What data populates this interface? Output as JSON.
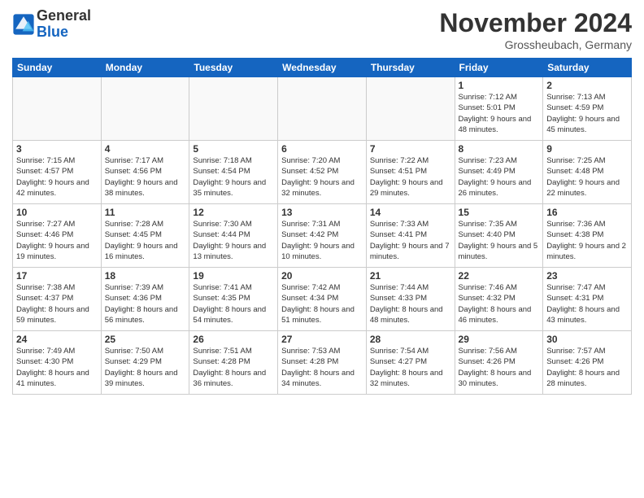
{
  "header": {
    "logo_general": "General",
    "logo_blue": "Blue",
    "month_title": "November 2024",
    "location": "Grossheubach, Germany"
  },
  "days_of_week": [
    "Sunday",
    "Monday",
    "Tuesday",
    "Wednesday",
    "Thursday",
    "Friday",
    "Saturday"
  ],
  "weeks": [
    [
      {
        "day": "",
        "info": ""
      },
      {
        "day": "",
        "info": ""
      },
      {
        "day": "",
        "info": ""
      },
      {
        "day": "",
        "info": ""
      },
      {
        "day": "",
        "info": ""
      },
      {
        "day": "1",
        "info": "Sunrise: 7:12 AM\nSunset: 5:01 PM\nDaylight: 9 hours and 48 minutes."
      },
      {
        "day": "2",
        "info": "Sunrise: 7:13 AM\nSunset: 4:59 PM\nDaylight: 9 hours and 45 minutes."
      }
    ],
    [
      {
        "day": "3",
        "info": "Sunrise: 7:15 AM\nSunset: 4:57 PM\nDaylight: 9 hours and 42 minutes."
      },
      {
        "day": "4",
        "info": "Sunrise: 7:17 AM\nSunset: 4:56 PM\nDaylight: 9 hours and 38 minutes."
      },
      {
        "day": "5",
        "info": "Sunrise: 7:18 AM\nSunset: 4:54 PM\nDaylight: 9 hours and 35 minutes."
      },
      {
        "day": "6",
        "info": "Sunrise: 7:20 AM\nSunset: 4:52 PM\nDaylight: 9 hours and 32 minutes."
      },
      {
        "day": "7",
        "info": "Sunrise: 7:22 AM\nSunset: 4:51 PM\nDaylight: 9 hours and 29 minutes."
      },
      {
        "day": "8",
        "info": "Sunrise: 7:23 AM\nSunset: 4:49 PM\nDaylight: 9 hours and 26 minutes."
      },
      {
        "day": "9",
        "info": "Sunrise: 7:25 AM\nSunset: 4:48 PM\nDaylight: 9 hours and 22 minutes."
      }
    ],
    [
      {
        "day": "10",
        "info": "Sunrise: 7:27 AM\nSunset: 4:46 PM\nDaylight: 9 hours and 19 minutes."
      },
      {
        "day": "11",
        "info": "Sunrise: 7:28 AM\nSunset: 4:45 PM\nDaylight: 9 hours and 16 minutes."
      },
      {
        "day": "12",
        "info": "Sunrise: 7:30 AM\nSunset: 4:44 PM\nDaylight: 9 hours and 13 minutes."
      },
      {
        "day": "13",
        "info": "Sunrise: 7:31 AM\nSunset: 4:42 PM\nDaylight: 9 hours and 10 minutes."
      },
      {
        "day": "14",
        "info": "Sunrise: 7:33 AM\nSunset: 4:41 PM\nDaylight: 9 hours and 7 minutes."
      },
      {
        "day": "15",
        "info": "Sunrise: 7:35 AM\nSunset: 4:40 PM\nDaylight: 9 hours and 5 minutes."
      },
      {
        "day": "16",
        "info": "Sunrise: 7:36 AM\nSunset: 4:38 PM\nDaylight: 9 hours and 2 minutes."
      }
    ],
    [
      {
        "day": "17",
        "info": "Sunrise: 7:38 AM\nSunset: 4:37 PM\nDaylight: 8 hours and 59 minutes."
      },
      {
        "day": "18",
        "info": "Sunrise: 7:39 AM\nSunset: 4:36 PM\nDaylight: 8 hours and 56 minutes."
      },
      {
        "day": "19",
        "info": "Sunrise: 7:41 AM\nSunset: 4:35 PM\nDaylight: 8 hours and 54 minutes."
      },
      {
        "day": "20",
        "info": "Sunrise: 7:42 AM\nSunset: 4:34 PM\nDaylight: 8 hours and 51 minutes."
      },
      {
        "day": "21",
        "info": "Sunrise: 7:44 AM\nSunset: 4:33 PM\nDaylight: 8 hours and 48 minutes."
      },
      {
        "day": "22",
        "info": "Sunrise: 7:46 AM\nSunset: 4:32 PM\nDaylight: 8 hours and 46 minutes."
      },
      {
        "day": "23",
        "info": "Sunrise: 7:47 AM\nSunset: 4:31 PM\nDaylight: 8 hours and 43 minutes."
      }
    ],
    [
      {
        "day": "24",
        "info": "Sunrise: 7:49 AM\nSunset: 4:30 PM\nDaylight: 8 hours and 41 minutes."
      },
      {
        "day": "25",
        "info": "Sunrise: 7:50 AM\nSunset: 4:29 PM\nDaylight: 8 hours and 39 minutes."
      },
      {
        "day": "26",
        "info": "Sunrise: 7:51 AM\nSunset: 4:28 PM\nDaylight: 8 hours and 36 minutes."
      },
      {
        "day": "27",
        "info": "Sunrise: 7:53 AM\nSunset: 4:28 PM\nDaylight: 8 hours and 34 minutes."
      },
      {
        "day": "28",
        "info": "Sunrise: 7:54 AM\nSunset: 4:27 PM\nDaylight: 8 hours and 32 minutes."
      },
      {
        "day": "29",
        "info": "Sunrise: 7:56 AM\nSunset: 4:26 PM\nDaylight: 8 hours and 30 minutes."
      },
      {
        "day": "30",
        "info": "Sunrise: 7:57 AM\nSunset: 4:26 PM\nDaylight: 8 hours and 28 minutes."
      }
    ]
  ]
}
